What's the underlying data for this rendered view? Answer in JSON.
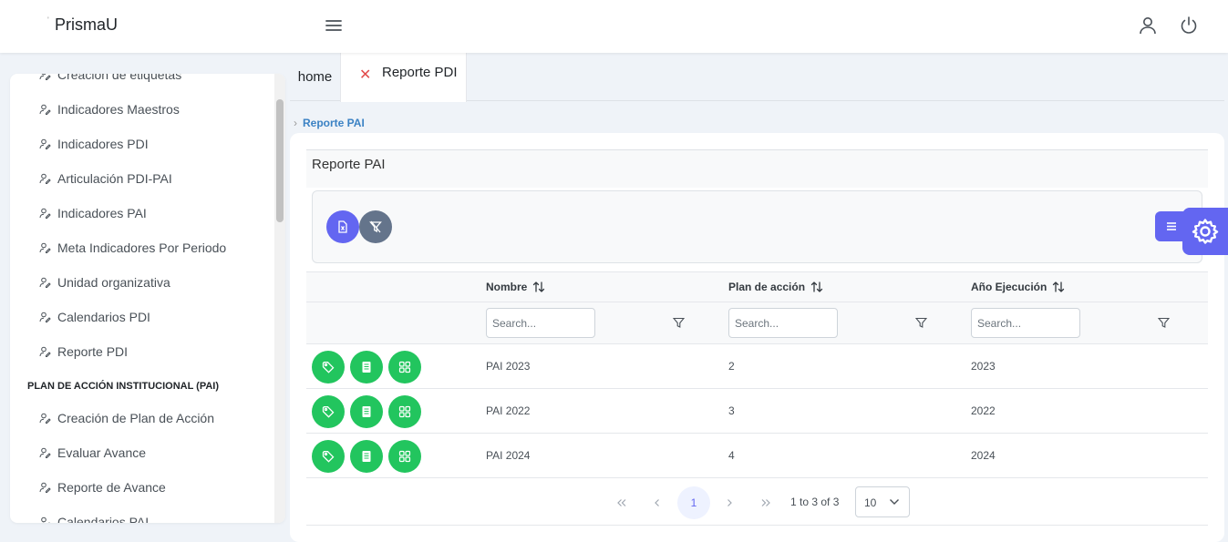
{
  "app": {
    "title": "PrismaU"
  },
  "sidebar": {
    "items_top": [
      {
        "label": "Creación de etiquetas"
      },
      {
        "label": "Indicadores Maestros"
      },
      {
        "label": "Indicadores PDI"
      },
      {
        "label": "Articulación PDI-PAI"
      },
      {
        "label": "Indicadores PAI"
      },
      {
        "label": "Meta Indicadores Por Periodo"
      },
      {
        "label": "Unidad organizativa"
      },
      {
        "label": "Calendarios PDI"
      },
      {
        "label": "Reporte PDI"
      }
    ],
    "section_pai": "PLAN DE ACCIÓN INSTITUCIONAL (PAI)",
    "items_pai": [
      {
        "label": "Creación de Plan de Acción"
      },
      {
        "label": "Evaluar Avance"
      },
      {
        "label": "Reporte de Avance"
      },
      {
        "label": "Calendarios PAI"
      }
    ]
  },
  "tabs": [
    {
      "label": "home"
    },
    {
      "label": "Reporte PDI"
    }
  ],
  "breadcrumb": {
    "current": "Reporte PAI"
  },
  "card": {
    "title": "Reporte PAI"
  },
  "table": {
    "columns": [
      "Nombre",
      "Plan de acción",
      "Año Ejecución"
    ],
    "search_placeholder": "Search...",
    "rows": [
      {
        "nombre": "PAI 2023",
        "plan": "2",
        "anio": "2023"
      },
      {
        "nombre": "PAI 2022",
        "plan": "3",
        "anio": "2022"
      },
      {
        "nombre": "PAI 2024",
        "plan": "4",
        "anio": "2024"
      }
    ]
  },
  "pagination": {
    "current_page": "1",
    "info": "1 to 3 of 3",
    "page_size": "10"
  },
  "colors": {
    "primary": "#6366f1",
    "success": "#22c55e",
    "secondary": "#64748b",
    "danger": "#e24c4c",
    "link": "#3b82c4"
  },
  "icons": {
    "menu": "hamburger-icon",
    "user": "user-icon",
    "power": "power-icon",
    "excel": "file-excel-icon",
    "clear_filter": "filter-slash-icon",
    "tag": "tag-icon",
    "report": "file-text-icon",
    "grid": "grid-icon",
    "settings": "gear-icon"
  }
}
